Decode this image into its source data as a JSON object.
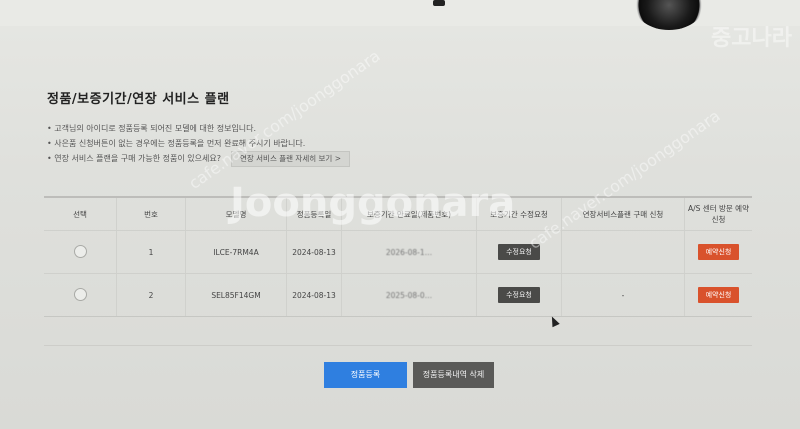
{
  "page": {
    "title": "정품/보증기간/연장 서비스 플랜",
    "notes": [
      "• 고객님의 아이디로 정품등록 되어진 모델에 대한 정보입니다.",
      "• 사은품 신청버튼이 없는 경우에는 정품등록을 먼저 완료해 주시기 바랍니다.",
      "• 연장 서비스 플랜을 구매 가능한 정품이 있으세요?"
    ],
    "detail_button": "연장 서비스 플랜 자세히 보기 >"
  },
  "table": {
    "headers": [
      "선택",
      "번호",
      "모델명",
      "정품등록일",
      "보증기간 만료일(제품번호)",
      "보증기간 수정요청",
      "연장서비스플랜 구매 신청",
      "A/S 센터 방문 예약 신청"
    ],
    "rows": [
      {
        "no": "1",
        "model": "ILCE-7RM4A",
        "reg_date": "2024-08-13",
        "expiry": "2026-08-1…",
        "edit_label": "수정요청",
        "plan": "",
        "reserve_label": "예약신청"
      },
      {
        "no": "2",
        "model": "SEL85F14GM",
        "reg_date": "2024-08-13",
        "expiry": "2025-08-0…",
        "edit_label": "수정요청",
        "plan": "-",
        "reserve_label": "예약신청"
      }
    ]
  },
  "actions": {
    "register": "정품등록",
    "delete": "정품등록내역 삭제"
  },
  "watermarks": {
    "big": "Joonggonara",
    "diag": "cafe.naver.com/joonggonara",
    "corner": "중고나라"
  },
  "colors": {
    "primary": "#2f7fe0",
    "danger": "#d9522c",
    "dark_button": "#4a4a48"
  }
}
